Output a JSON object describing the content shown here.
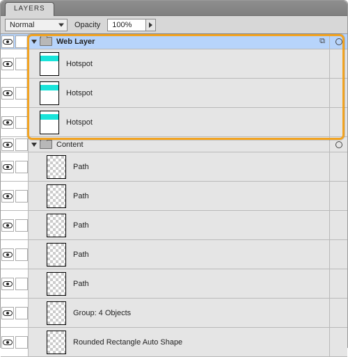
{
  "panel": {
    "tab": "LAYERS"
  },
  "opts": {
    "blend_mode": "Normal",
    "opacity_label": "Opacity",
    "opacity_value": "100%"
  },
  "layers": {
    "web_layer": {
      "label": "Web Layer",
      "items": [
        {
          "label": "Hotspot"
        },
        {
          "label": "Hotspot"
        },
        {
          "label": "Hotspot"
        }
      ]
    },
    "content": {
      "label": "Content",
      "items": [
        {
          "label": "Path"
        },
        {
          "label": "Path"
        },
        {
          "label": "Path"
        },
        {
          "label": "Path"
        },
        {
          "label": "Path"
        },
        {
          "label": "Group: 4 Objects"
        },
        {
          "label": "Rounded Rectangle Auto Shape"
        }
      ]
    }
  }
}
